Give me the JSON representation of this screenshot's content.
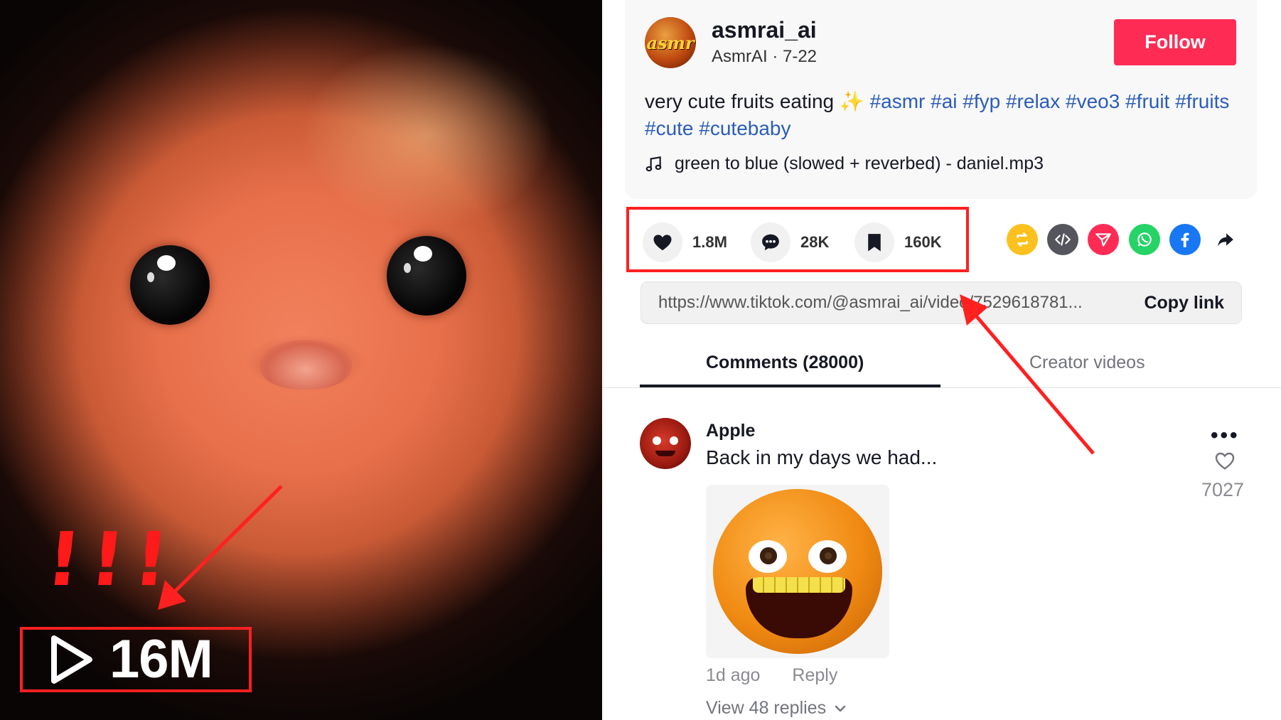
{
  "video": {
    "overlay_exclaim": "!!!",
    "view_count": "16M"
  },
  "author": {
    "username": "asmrai_ai",
    "avatar_text": "asmr",
    "display_name_date": "AsmrAI · 7-22",
    "follow_label": "Follow"
  },
  "caption": {
    "text": "very cute fruits eating",
    "sparkle": "✨",
    "hashtags": "#asmr #ai #fyp #relax #veo3 #fruit #fruits #cute #cutebaby"
  },
  "music": {
    "track": "green to blue (slowed + reverbed) - daniel.mp3"
  },
  "stats": {
    "likes": "1.8M",
    "comments": "28K",
    "saves": "160K"
  },
  "share_icons": [
    "repost-icon",
    "embed-icon",
    "send-icon",
    "whatsapp-icon",
    "facebook-icon",
    "share-arrow-icon"
  ],
  "link": {
    "url": "https://www.tiktok.com/@asmrai_ai/video/7529618781...",
    "copy_label": "Copy link"
  },
  "tabs": {
    "comments": "Comments (28000)",
    "creator_videos": "Creator videos"
  },
  "comment": {
    "author": "Apple",
    "text": "Back in my days we had...",
    "time": "1d ago",
    "reply_label": "Reply",
    "view_replies": "View 48 replies",
    "like_count": "7027",
    "more": "•••"
  },
  "colors": {
    "follow_bg": "#fe2c55",
    "hashtag": "#2b5db9",
    "annotation_red": "#ff2020"
  }
}
